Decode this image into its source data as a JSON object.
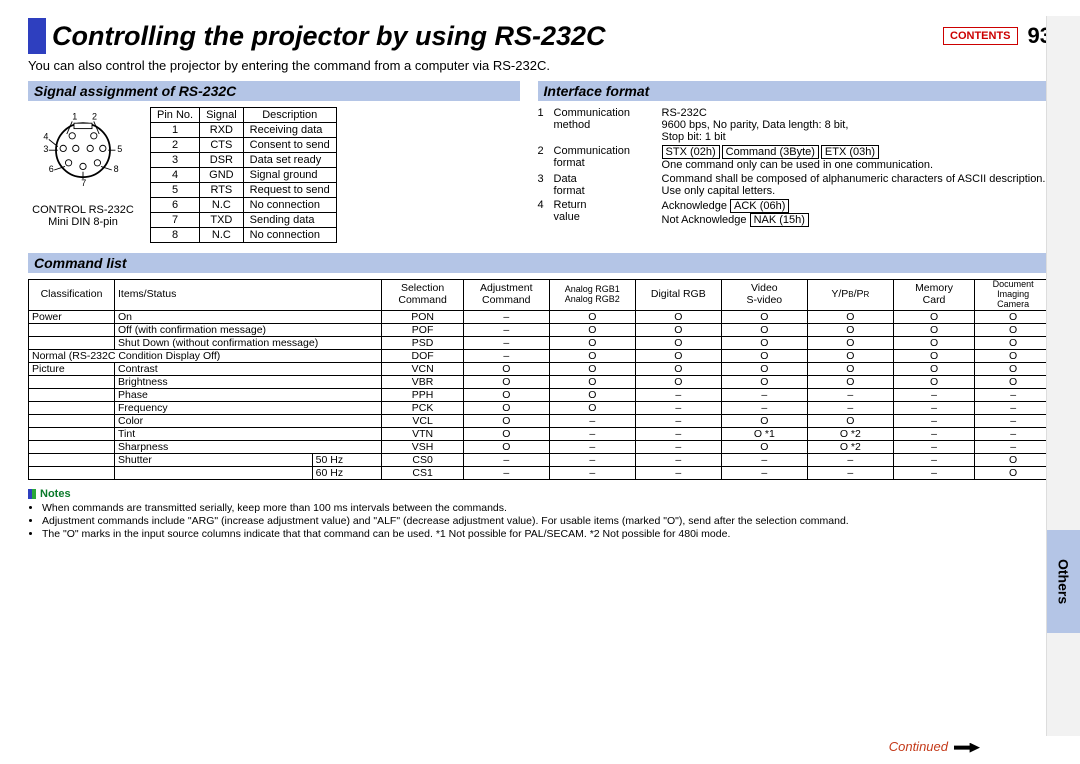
{
  "page": {
    "title": "Controlling the projector by using RS-232C",
    "contents_btn": "CONTENTS",
    "number": "93",
    "intro": "You can also control the projector by entering the command from a computer via RS-232C."
  },
  "sig": {
    "heading": "Signal assignment of RS-232C",
    "connector_label1": "CONTROL RS-232C",
    "connector_label2": "Mini DIN 8-pin",
    "pins_header": {
      "c1": "Pin No.",
      "c2": "Signal",
      "c3": "Description"
    },
    "pins": [
      {
        "n": "1",
        "s": "RXD",
        "d": "Receiving data"
      },
      {
        "n": "2",
        "s": "CTS",
        "d": "Consent to send"
      },
      {
        "n": "3",
        "s": "DSR",
        "d": "Data set ready"
      },
      {
        "n": "4",
        "s": "GND",
        "d": "Signal ground"
      },
      {
        "n": "5",
        "s": "RTS",
        "d": "Request to send"
      },
      {
        "n": "6",
        "s": "N.C",
        "d": "No connection"
      },
      {
        "n": "7",
        "s": "TXD",
        "d": "Sending data"
      },
      {
        "n": "8",
        "s": "N.C",
        "d": "No connection"
      }
    ]
  },
  "iface": {
    "heading": "Interface format",
    "rows": [
      {
        "n": "1",
        "lbl": "Communication method",
        "val_plain": "RS-232C\n9600 bps, No parity, Data length: 8 bit,\nStop bit: 1 bit"
      },
      {
        "n": "2",
        "lbl": "Communication format",
        "boxes": [
          "STX (02h)",
          "Command (3Byte)",
          "ETX (03h)"
        ],
        "tail": "One command only can be used in one communication."
      },
      {
        "n": "3",
        "lbl": "Data format",
        "val_plain": "Command shall be composed of alphanumeric characters of ASCII description. Use only capital letters."
      },
      {
        "n": "4",
        "lbl": "Return value",
        "ack": {
          "pre": "Acknowledge",
          "box": "ACK (06h)"
        },
        "nak": {
          "pre": "Not Acknowledge",
          "box": "NAK (15h)"
        }
      }
    ]
  },
  "cmd": {
    "heading": "Command list",
    "headers": {
      "c1": "Classification",
      "c2": "Items/Status",
      "c3a": "Selection",
      "c3b": "Command",
      "c4a": "Adjustment",
      "c4b": "Command",
      "c5a": "Analog RGB1",
      "c5b": "Analog RGB2",
      "c6": "Digital RGB",
      "c7a": "Video",
      "c7b": "S-video",
      "c8": "Y/PB/PR",
      "c9a": "Memory",
      "c9b": "Card",
      "c10a": "Document",
      "c10b": "Imaging",
      "c10c": "Camera"
    },
    "rows": [
      {
        "cls": "Power",
        "item": "On",
        "sel": "PON",
        "adj": "–",
        "a": "O",
        "b": "O",
        "c": "O",
        "d": "O",
        "e": "O",
        "f": "O"
      },
      {
        "cls": "",
        "item": "Off (with confirmation message)",
        "sel": "POF",
        "adj": "–",
        "a": "O",
        "b": "O",
        "c": "O",
        "d": "O",
        "e": "O",
        "f": "O"
      },
      {
        "cls": "",
        "item": "Shut Down (without confirmation message)",
        "sel": "PSD",
        "adj": "–",
        "a": "O",
        "b": "O",
        "c": "O",
        "d": "O",
        "e": "O",
        "f": "O"
      },
      {
        "cls_full": "Normal (RS-232C Condition Display Off)",
        "sel": "DOF",
        "adj": "–",
        "a": "O",
        "b": "O",
        "c": "O",
        "d": "O",
        "e": "O",
        "f": "O"
      },
      {
        "cls": "Picture",
        "item": "Contrast",
        "sel": "VCN",
        "adj": "O",
        "a": "O",
        "b": "O",
        "c": "O",
        "d": "O",
        "e": "O",
        "f": "O"
      },
      {
        "cls": "",
        "item": "Brightness",
        "sel": "VBR",
        "adj": "O",
        "a": "O",
        "b": "O",
        "c": "O",
        "d": "O",
        "e": "O",
        "f": "O"
      },
      {
        "cls": "",
        "item": "Phase",
        "sel": "PPH",
        "adj": "O",
        "a": "O",
        "b": "–",
        "c": "–",
        "d": "–",
        "e": "–",
        "f": "–"
      },
      {
        "cls": "",
        "item": "Frequency",
        "sel": "PCK",
        "adj": "O",
        "a": "O",
        "b": "–",
        "c": "–",
        "d": "–",
        "e": "–",
        "f": "–"
      },
      {
        "cls": "",
        "item": "Color",
        "sel": "VCL",
        "adj": "O",
        "a": "–",
        "b": "–",
        "c": "O",
        "d": "O",
        "e": "–",
        "f": "–"
      },
      {
        "cls": "",
        "item": "Tint",
        "sel": "VTN",
        "adj": "O",
        "a": "–",
        "b": "–",
        "c": "O *1",
        "d": "O *2",
        "e": "–",
        "f": "–"
      },
      {
        "cls": "",
        "item": "Sharpness",
        "sel": "VSH",
        "adj": "O",
        "a": "–",
        "b": "–",
        "c": "O",
        "d": "O *2",
        "e": "–",
        "f": "–"
      },
      {
        "cls": "",
        "item": "Shutter",
        "sub": "50 Hz",
        "sel": "CS0",
        "adj": "–",
        "a": "–",
        "b": "–",
        "c": "–",
        "d": "–",
        "e": "–",
        "f": "O"
      },
      {
        "cls": "",
        "item": "",
        "sub": "60 Hz",
        "sel": "CS1",
        "adj": "–",
        "a": "–",
        "b": "–",
        "c": "–",
        "d": "–",
        "e": "–",
        "f": "O"
      }
    ]
  },
  "notes": {
    "label": "Notes",
    "items": [
      "When commands are transmitted serially, keep more than 100 ms intervals between the commands.",
      "Adjustment commands include \"ARG\" (increase adjustment value) and \"ALF\" (decrease adjustment value).  For usable items (marked \"O\"), send after the selection command.",
      "The \"O\" marks in the input source columns indicate that that command can be used. *1 Not possible for PAL/SECAM. *2 Not possible for 480i mode."
    ]
  },
  "footer": {
    "continued": "Continued"
  },
  "side": {
    "active": "Others"
  }
}
